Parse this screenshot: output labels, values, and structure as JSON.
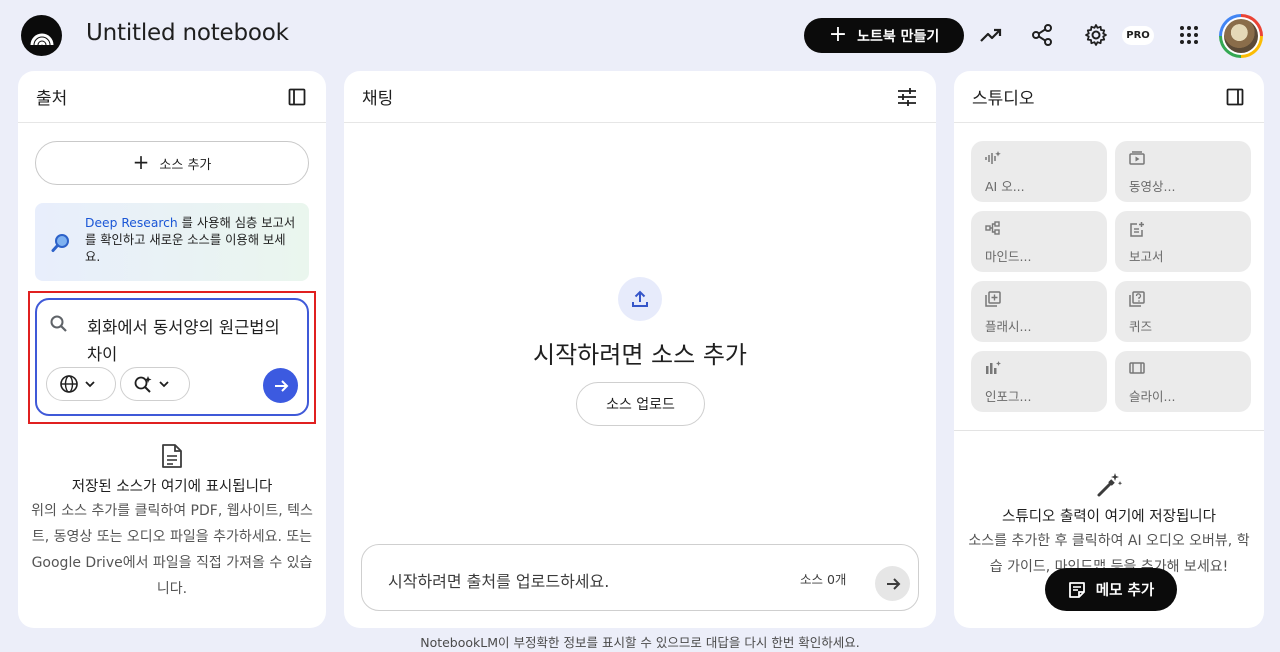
{
  "header": {
    "title": "Untitled notebook",
    "create_button": "노트북 만들기",
    "pro_badge": "PRO",
    "icons": [
      "analytics-icon",
      "share-icon",
      "settings-icon",
      "apps-grid-icon"
    ]
  },
  "sources": {
    "title": "출처",
    "add_source": "소스 추가",
    "deep_research": {
      "link": "Deep Research",
      "text": " 를 사용해 심층 보고서를 확인하고 새로운 소스를 이용해 보세요."
    },
    "search": {
      "query": "회화에서 동서양의 원근법의 차이"
    },
    "empty": {
      "heading": "저장된 소스가 여기에 표시됩니다",
      "description": "위의 소스 추가를 클릭하여 PDF, 웹사이트, 텍스트, 동영상 또는 오디오 파일을 추가하세요. 또는 Google Drive에서 파일을 직접 가져올 수 있습니다."
    }
  },
  "chat": {
    "title": "채팅",
    "heading": "시작하려면 소스 추가",
    "upload_button": "소스 업로드",
    "input_placeholder": "시작하려면 출처를 업로드하세요.",
    "source_count": "소스 0개"
  },
  "studio": {
    "title": "스튜디오",
    "tiles": [
      {
        "label": "AI 오...",
        "icon": "audio-waveform-icon"
      },
      {
        "label": "동영상...",
        "icon": "video-icon"
      },
      {
        "label": "마인드...",
        "icon": "mindmap-icon"
      },
      {
        "label": "보고서",
        "icon": "report-icon"
      },
      {
        "label": "플래시...",
        "icon": "flashcards-icon"
      },
      {
        "label": "퀴즈",
        "icon": "quiz-icon"
      },
      {
        "label": "인포그...",
        "icon": "infographic-icon"
      },
      {
        "label": "슬라이...",
        "icon": "slides-icon"
      }
    ],
    "empty": {
      "heading": "스튜디오 출력이 여기에 저장됩니다",
      "description": "소스를 추가한 후 클릭하여 AI 오디오 오버뷰, 학습 가이드, 마인드맵 등을 추가해 보세요!"
    },
    "memo_button": "메모 추가"
  },
  "footer": {
    "disclaimer": "NotebookLM이 부정확한 정보를 표시할 수 있으므로 대답을 다시 한번 확인하세요."
  },
  "colors": {
    "background": "#eceef9",
    "accent_blue": "#3c5ae0",
    "highlight_red": "#e02020",
    "dark_button": "#0b0b0b"
  }
}
